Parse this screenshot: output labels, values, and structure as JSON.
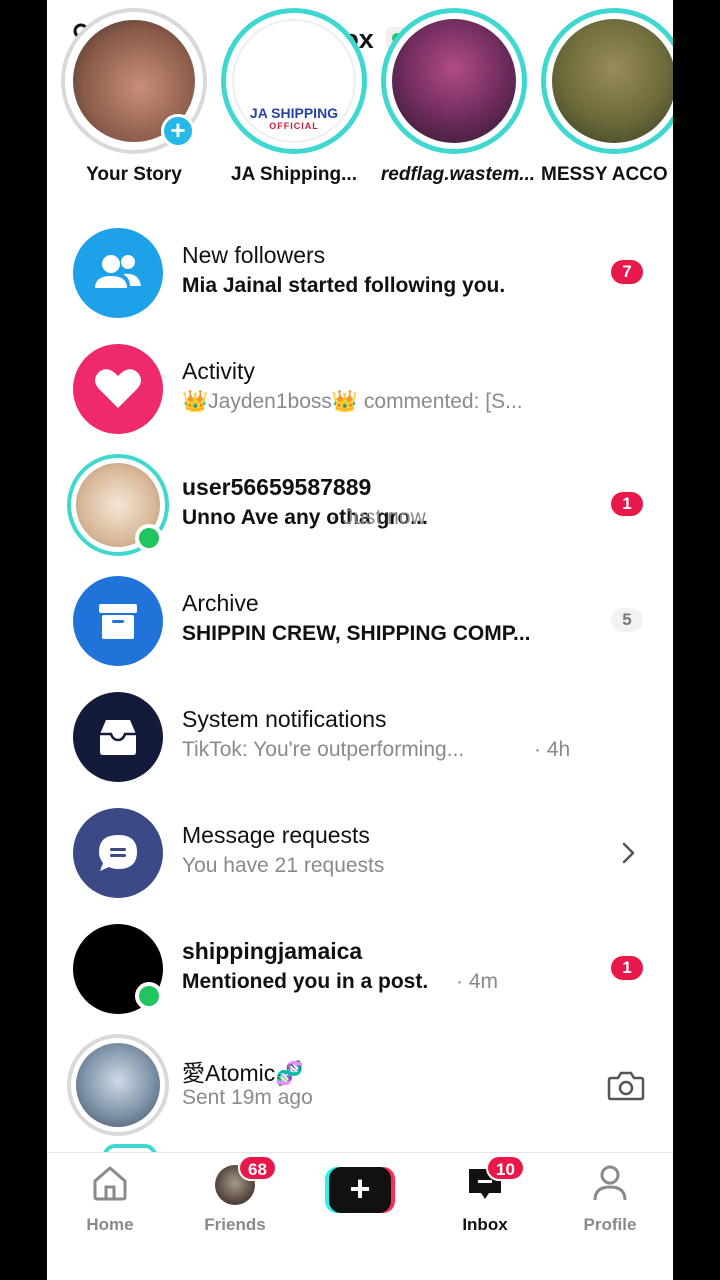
{
  "header": {
    "title": "Inbox"
  },
  "stories": [
    {
      "label": "Your Story"
    },
    {
      "label": "JA Shipping...",
      "logo_line1": "JA SHIPPING",
      "logo_line2": "OFFICIAL"
    },
    {
      "label": "redflag.wastem..."
    },
    {
      "label": "MESSY ACCO"
    }
  ],
  "rows": [
    {
      "title": "New followers",
      "subtitle": "Mia Jainal started following you.",
      "badge": "7"
    },
    {
      "title": "Activity",
      "subtitle": "👑Jayden1boss👑 commented: [S..."
    },
    {
      "title": "user56659587889",
      "subtitle": "Unno Ave any otha gro...",
      "time": "· Just now",
      "badge": "1"
    },
    {
      "title": "Archive",
      "subtitle": "SHIPPIN CREW, SHIPPING COMP...",
      "badge": "5"
    },
    {
      "title": "System notifications",
      "subtitle": "TikTok: You're outperforming...",
      "time": "· 4h"
    },
    {
      "title": "Message requests",
      "subtitle": "You have 21 requests"
    },
    {
      "title": "shippingjamaica",
      "subtitle": "Mentioned you in a post.",
      "time": "· 4m",
      "badge": "1"
    },
    {
      "title": "愛Atomic🧬",
      "subtitle": "Sent 19m ago"
    }
  ],
  "nav": {
    "home": "Home",
    "friends": "Friends",
    "friends_badge": "68",
    "inbox": "Inbox",
    "inbox_badge": "10",
    "profile": "Profile"
  },
  "colors": {
    "accent_red": "#e8194a",
    "online_green": "#20c560",
    "followers_blue": "#1da1e8",
    "activity_pink": "#ef2a6b",
    "archive_blue": "#1f73d9",
    "system_navy": "#141a3a",
    "requests_indigo": "#3b4a86"
  }
}
